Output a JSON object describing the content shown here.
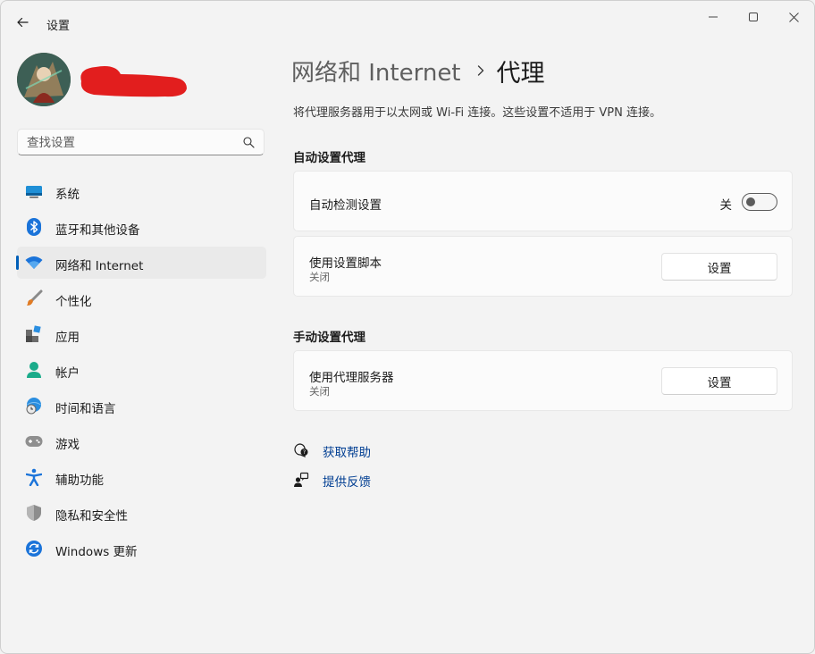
{
  "app": {
    "title": "设置"
  },
  "search": {
    "placeholder": "查找设置"
  },
  "sidebar": {
    "items": [
      {
        "label": "系统",
        "icon": "system-monitor-icon"
      },
      {
        "label": "蓝牙和其他设备",
        "icon": "bluetooth-icon"
      },
      {
        "label": "网络和 Internet",
        "icon": "wifi-icon",
        "selected": true
      },
      {
        "label": "个性化",
        "icon": "paintbrush-icon"
      },
      {
        "label": "应用",
        "icon": "apps-icon"
      },
      {
        "label": "帐户",
        "icon": "account-icon"
      },
      {
        "label": "时间和语言",
        "icon": "globe-clock-icon"
      },
      {
        "label": "游戏",
        "icon": "gamepad-icon"
      },
      {
        "label": "辅助功能",
        "icon": "accessibility-icon"
      },
      {
        "label": "隐私和安全性",
        "icon": "shield-icon"
      },
      {
        "label": "Windows 更新",
        "icon": "update-icon"
      }
    ]
  },
  "main": {
    "breadcrumb_parent": "网络和 Internet",
    "breadcrumb_current": "代理",
    "description": "将代理服务器用于以太网或 Wi-Fi 连接。这些设置不适用于 VPN 连接。",
    "auto_section": {
      "title": "自动设置代理",
      "auto_detect": {
        "label": "自动检测设置",
        "toggle_state": "关",
        "on": false
      },
      "use_script": {
        "label": "使用设置脚本",
        "status": "关闭",
        "button": "设置"
      }
    },
    "manual_section": {
      "title": "手动设置代理",
      "use_proxy": {
        "label": "使用代理服务器",
        "status": "关闭",
        "button": "设置"
      }
    },
    "links": {
      "help": "获取帮助",
      "feedback": "提供反馈"
    }
  },
  "colors": {
    "accent": "#005fb8",
    "link": "#003e92",
    "background": "#f3f3f3",
    "card": "#fbfbfb"
  }
}
